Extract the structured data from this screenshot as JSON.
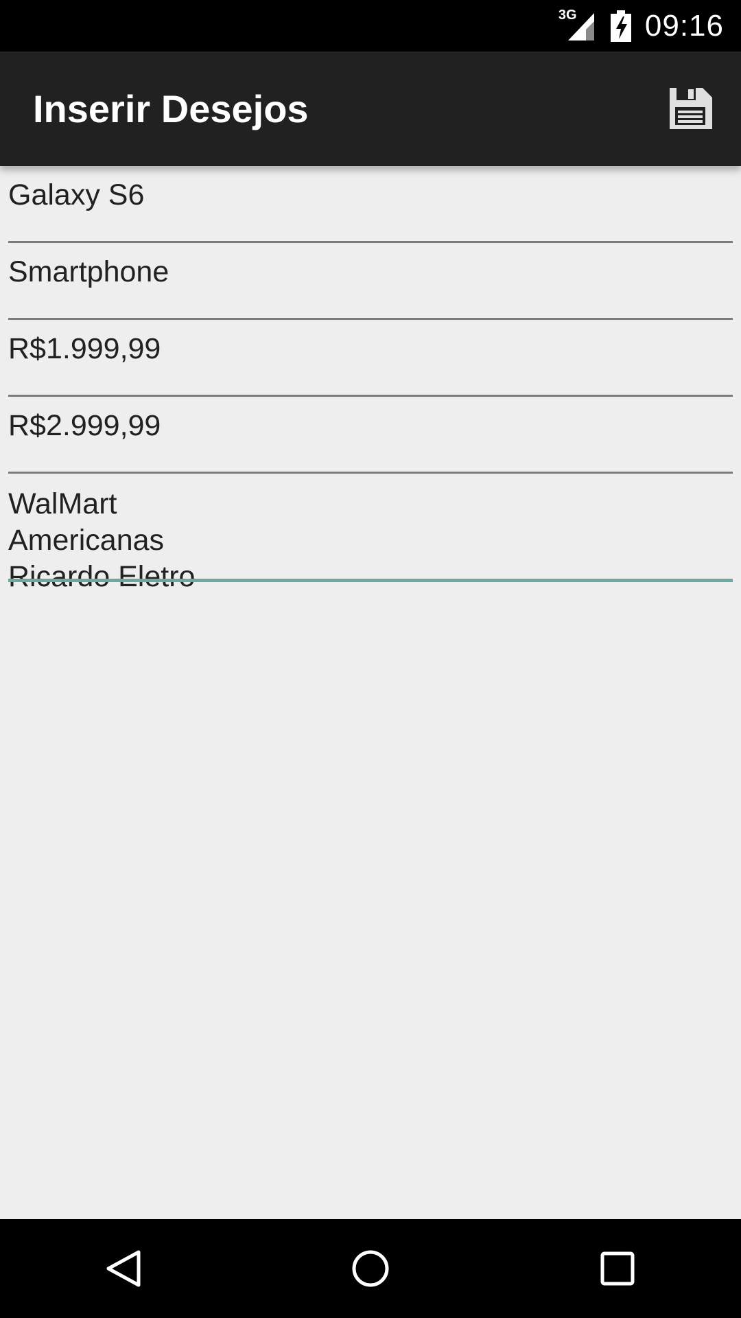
{
  "status_bar": {
    "network_label": "3G",
    "time": "09:16",
    "icons": [
      "signal-icon",
      "battery-charging-icon"
    ]
  },
  "app_bar": {
    "title": "Inserir Desejos",
    "save_icon": "save-icon"
  },
  "form": {
    "fields": [
      {
        "value": "Galaxy S6"
      },
      {
        "value": "Smartphone"
      },
      {
        "value": "R$1.999,99"
      },
      {
        "value": "R$2.999,99"
      }
    ],
    "stores": {
      "lines": [
        "WalMart",
        "Americanas",
        "Ricardo Eletro"
      ],
      "focused": true
    }
  },
  "nav_bar": {
    "icons": [
      "back-icon",
      "home-icon",
      "recents-icon"
    ]
  },
  "colors": {
    "status_bar": "#000000",
    "app_bar": "#212121",
    "background": "#eeeeee",
    "field_line": "#7c7c7c",
    "focused_line": "#6aa8a0"
  }
}
